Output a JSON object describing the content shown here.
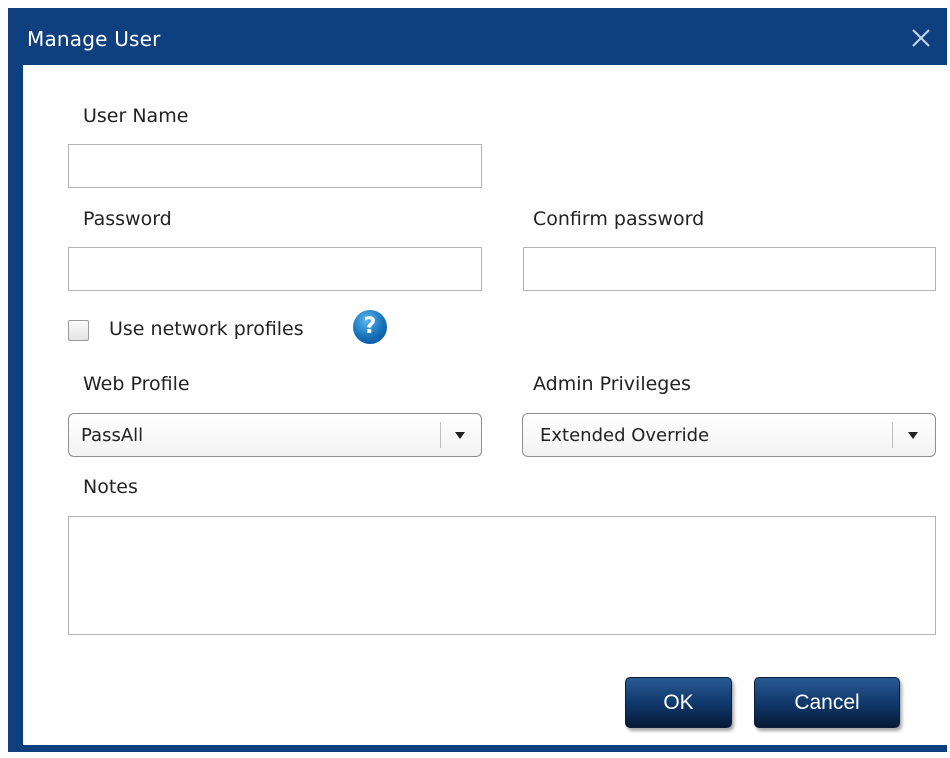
{
  "dialog": {
    "title": "Manage User",
    "close_icon": "close-icon"
  },
  "form": {
    "user_name_label": "User Name",
    "user_name_value": "",
    "password_label": "Password",
    "password_value": "",
    "confirm_password_label": "Confirm password",
    "confirm_password_value": "",
    "use_network_profiles_label": "Use network profiles",
    "use_network_profiles_checked": false,
    "help_icon_glyph": "?",
    "web_profile_label": "Web Profile",
    "web_profile_value": "PassAll",
    "admin_privileges_label": "Admin Privileges",
    "admin_privileges_value": "Extended Override",
    "notes_label": "Notes",
    "notes_value": ""
  },
  "buttons": {
    "ok_label": "OK",
    "cancel_label": "Cancel"
  },
  "colors": {
    "frame": "#0e3f7e",
    "button": "#0f3669",
    "help_icon": "#1570b8"
  }
}
